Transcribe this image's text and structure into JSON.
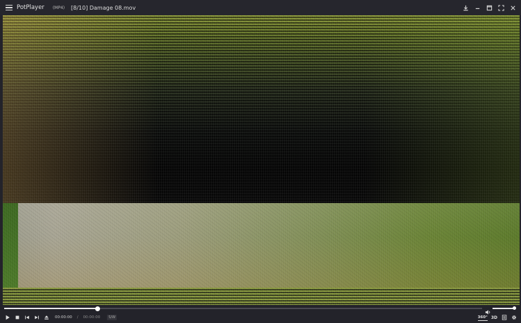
{
  "window": {
    "app_name": "PotPlayer",
    "format_badge": "(MP4)",
    "file_title": "[8/10] Damage 08.mov",
    "controls": {
      "download_icon": "download-icon",
      "minimize_icon": "minimize-icon",
      "restore_icon": "restore-icon",
      "fullscreen_icon": "fullscreen-icon",
      "close_icon": "close-icon"
    }
  },
  "video": {
    "description_colors": {
      "top": "#6a7a2e",
      "dark_band": "#0b0b0b",
      "bottom": "#829059"
    }
  },
  "playback": {
    "progress_fraction": 0.195,
    "volume_fraction": 1.0,
    "current_time": "00:00:00",
    "separator": "/",
    "total_time": "00:00:00",
    "codec_badge": "S/W",
    "vr_label": "360°",
    "threed_label": "3D"
  },
  "colors": {
    "accent": "#e8e8e8",
    "title_bar": "#26262d",
    "track": "#4a4a52"
  }
}
